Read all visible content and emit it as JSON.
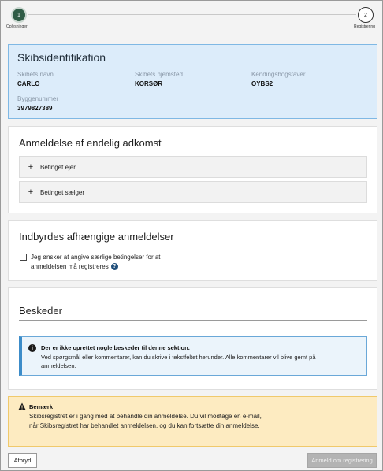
{
  "stepper": {
    "steps": [
      {
        "number": "1",
        "label": "Oplysninger"
      },
      {
        "number": "2",
        "label": "Registrering"
      }
    ]
  },
  "ident": {
    "title": "Skibsidentifikation",
    "name_label": "Skibets navn",
    "name_value": "CARLO",
    "home_label": "Skibets hjemsted",
    "home_value": "KORSØR",
    "call_label": "Kendingsbogstaver",
    "call_value": "OYBS2",
    "build_label": "Byggenummer",
    "build_value": "3979827389"
  },
  "anmeldelse": {
    "title": "Anmeldelse af endelig adkomst",
    "items": [
      {
        "icon": "+",
        "label": "Betinget ejer"
      },
      {
        "icon": "+",
        "label": "Betinget sælger"
      }
    ]
  },
  "indbyrdes": {
    "title": "Indbyrdes afhængige anmeldelser",
    "checkbox_label": "Jeg ønsker at angive særlige betingelser for at anmeldelsen må registreres",
    "help_glyph": "?"
  },
  "beskeder": {
    "title": "Beskeder",
    "info_glyph": "i",
    "info_title": "Der er ikke oprettet nogle beskeder til denne sektion.",
    "info_text": "Ved spørgsmål eller kommentarer, kan du skrive i tekstfeltet herunder. Alle kommentarer vil blive gemt på anmeldelsen."
  },
  "warning": {
    "title": "Bemærk",
    "text": "Skibsregistret er i gang med at behandle din anmeldelse. Du vil modtage en e-mail, når Skibsregistret har behandlet anmeldelsen, og du kan fortsætte din anmeldelse."
  },
  "footer": {
    "cancel_label": "Afbryd",
    "submit_label": "Anmeld om registrering"
  }
}
